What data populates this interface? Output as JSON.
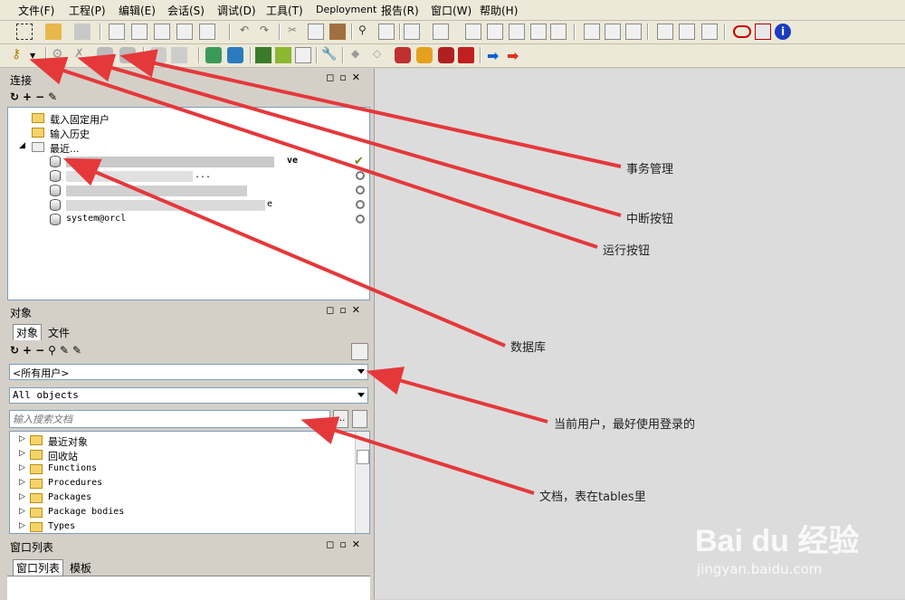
{
  "menu": [
    "文件(F)",
    "工程(P)",
    "编辑(E)",
    "会话(S)",
    "调试(D)",
    "工具(T)",
    "Deployment",
    "报告(R)",
    "窗口(W)",
    "帮助(H)"
  ],
  "connections_panel": {
    "title": "连接",
    "tree": [
      {
        "label": "载入固定用户",
        "type": "folder"
      },
      {
        "label": "输入历史",
        "type": "folder"
      },
      {
        "label": "最近...",
        "type": "folder-open"
      }
    ],
    "recent": [
      {
        "label": "ve",
        "obscured": true
      },
      {
        "label": "...",
        "obscured": true
      },
      {
        "label": "",
        "obscured": true
      },
      {
        "label": "e",
        "obscured": true
      },
      {
        "label": "system@orcl",
        "obscured": false
      }
    ]
  },
  "objects_panel": {
    "title": "对象",
    "tabs": [
      "对象",
      "文件"
    ],
    "user_select": "<所有用户>",
    "type_select": "All objects",
    "search_placeholder": "输入搜索文档",
    "ellipsis_label": "...",
    "tree": [
      "最近对象",
      "回收站",
      "Functions",
      "Procedures",
      "Packages",
      "Package bodies",
      "Types"
    ]
  },
  "window_list_panel": {
    "title": "窗口列表",
    "tabs": [
      "窗口列表",
      "模板"
    ]
  },
  "annotations": {
    "tx": "事务管理",
    "abort": "中断按钮",
    "run": "运行按钮",
    "db": "数据库",
    "user": "当前用户，最好使用登录的",
    "doc": "文档，表在tables里"
  },
  "watermark": {
    "brand": "Bai du 经验",
    "url": "jingyan.baidu.com"
  },
  "colors": {
    "arrow": "#e5383b",
    "background": "#d4d0c8",
    "workspace": "#dcdcdc"
  }
}
